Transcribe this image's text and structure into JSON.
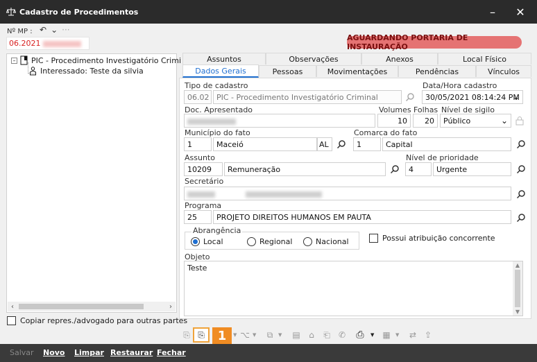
{
  "window": {
    "title": "Cadastro de Procedimentos",
    "app_icon": "scales-icon"
  },
  "header": {
    "mp_label": "Nº MP :",
    "mp_value": "06.2021",
    "status": "AGUARDANDO PORTARIA DE INSTAURAÇÃO"
  },
  "tree": {
    "items": [
      {
        "label": "PIC - Procedimento Investigatório Crimi"
      },
      {
        "label": "Interessado: Teste da silvia"
      }
    ]
  },
  "copy_option": "Copiar repres./advogado para outras partes",
  "tabs_row1": [
    "Assuntos",
    "Observações",
    "Anexos",
    "Local Físico"
  ],
  "tabs_row2": [
    "Dados Gerais",
    "Pessoas",
    "Movimentações",
    "Pendências",
    "Vínculos"
  ],
  "form": {
    "tipo_label": "Tipo de cadastro",
    "tipo_code": "06.02",
    "tipo_desc": "PIC - Procedimento Investigatório Criminal",
    "datahora_label": "Data/Hora cadastro",
    "datahora": "30/05/2021 08:14:24 PM",
    "doc_label": "Doc. Apresentado",
    "volumes_label": "Volumes",
    "volumes": "10",
    "folhas_label": "Folhas",
    "folhas": "20",
    "sigilo_label": "Nível de sigilo",
    "sigilo": "Público",
    "municipio_label": "Município do fato",
    "municipio_code": "1",
    "municipio_name": "Maceió",
    "uf": "AL",
    "comarca_label": "Comarca do fato",
    "comarca_code": "1",
    "comarca_name": "Capital",
    "assunto_label": "Assunto",
    "assunto_code": "10209",
    "assunto_name": "Remuneração",
    "prioridade_label": "Nível de prioridade",
    "prioridade_code": "4",
    "prioridade_name": "Urgente",
    "secretario_label": "Secretário",
    "programa_label": "Programa",
    "programa_code": "25",
    "programa_name": "PROJETO DIREITOS HUMANOS EM PAUTA",
    "abrangencia_label": "Abrangência",
    "abrangencia_options": [
      "Local",
      "Regional",
      "Nacional"
    ],
    "concorrente_label": "Possui atribuição concorrente",
    "objeto_label": "Objeto",
    "objeto": "Teste"
  },
  "toolbar": {
    "badge": "1"
  },
  "footer": [
    "Salvar",
    "Novo",
    "Limpar",
    "Restaurar",
    "Fechar"
  ]
}
